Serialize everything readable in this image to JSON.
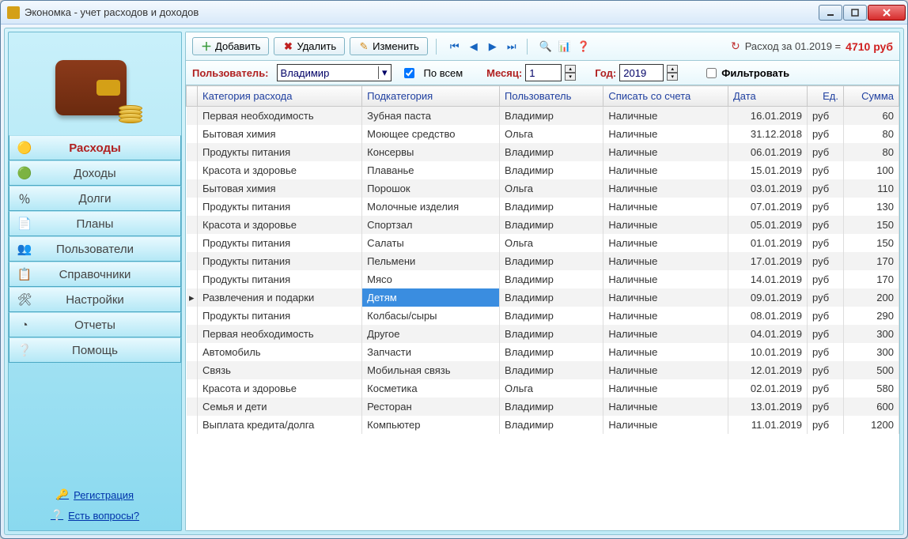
{
  "window": {
    "title": "Экономка - учет расходов и доходов"
  },
  "sidebar": {
    "items": [
      {
        "label": "Расходы",
        "icon": "coins-minus"
      },
      {
        "label": "Доходы",
        "icon": "coins-plus"
      },
      {
        "label": "Долги",
        "icon": "percent"
      },
      {
        "label": "Планы",
        "icon": "notes"
      },
      {
        "label": "Пользователи",
        "icon": "people"
      },
      {
        "label": "Справочники",
        "icon": "list"
      },
      {
        "label": "Настройки",
        "icon": "tools"
      },
      {
        "label": "Отчеты",
        "icon": "piechart"
      },
      {
        "label": "Помощь",
        "icon": "help"
      }
    ],
    "register": "Регистрация",
    "questions": "Есть вопросы?"
  },
  "toolbar": {
    "add": "Добавить",
    "delete": "Удалить",
    "edit": "Изменить",
    "summary_prefix": "Расход за 01.2019 = ",
    "summary_amount": "4710 руб"
  },
  "filter": {
    "user_label": "Пользователь:",
    "user_value": "Владимир",
    "all_label": "По всем",
    "month_label": "Месяц:",
    "month_value": "1",
    "year_label": "Год:",
    "year_value": "2019",
    "button": "Фильтровать"
  },
  "columns": [
    "Категория расхода",
    "Подкатегория",
    "Пользователь",
    "Списать со счета",
    "Дата",
    "Ед.",
    "Сумма"
  ],
  "rows": [
    {
      "cat": "Первая необходимость",
      "sub": "Зубная паста",
      "user": "Владимир",
      "acc": "Наличные",
      "date": "16.01.2019",
      "unit": "руб",
      "sum": "60"
    },
    {
      "cat": "Бытовая химия",
      "sub": "Моющее средство",
      "user": "Ольга",
      "acc": "Наличные",
      "date": "31.12.2018",
      "unit": "руб",
      "sum": "80"
    },
    {
      "cat": "Продукты питания",
      "sub": "Консервы",
      "user": "Владимир",
      "acc": "Наличные",
      "date": "06.01.2019",
      "unit": "руб",
      "sum": "80"
    },
    {
      "cat": "Красота и здоровье",
      "sub": "Плаванье",
      "user": "Владимир",
      "acc": "Наличные",
      "date": "15.01.2019",
      "unit": "руб",
      "sum": "100"
    },
    {
      "cat": "Бытовая химия",
      "sub": "Порошок",
      "user": "Ольга",
      "acc": "Наличные",
      "date": "03.01.2019",
      "unit": "руб",
      "sum": "110"
    },
    {
      "cat": "Продукты питания",
      "sub": "Молочные изделия",
      "user": "Владимир",
      "acc": "Наличные",
      "date": "07.01.2019",
      "unit": "руб",
      "sum": "130"
    },
    {
      "cat": "Красота и здоровье",
      "sub": "Спортзал",
      "user": "Владимир",
      "acc": "Наличные",
      "date": "05.01.2019",
      "unit": "руб",
      "sum": "150"
    },
    {
      "cat": "Продукты питания",
      "sub": "Салаты",
      "user": "Ольга",
      "acc": "Наличные",
      "date": "01.01.2019",
      "unit": "руб",
      "sum": "150"
    },
    {
      "cat": "Продукты питания",
      "sub": "Пельмени",
      "user": "Владимир",
      "acc": "Наличные",
      "date": "17.01.2019",
      "unit": "руб",
      "sum": "170"
    },
    {
      "cat": "Продукты питания",
      "sub": "Мясо",
      "user": "Владимир",
      "acc": "Наличные",
      "date": "14.01.2019",
      "unit": "руб",
      "sum": "170"
    },
    {
      "cat": "Развлечения и подарки",
      "sub": "Детям",
      "user": "Владимир",
      "acc": "Наличные",
      "date": "09.01.2019",
      "unit": "руб",
      "sum": "200",
      "selected": true
    },
    {
      "cat": "Продукты питания",
      "sub": "Колбасы/сыры",
      "user": "Владимир",
      "acc": "Наличные",
      "date": "08.01.2019",
      "unit": "руб",
      "sum": "290"
    },
    {
      "cat": "Первая необходимость",
      "sub": "Другое",
      "user": "Владимир",
      "acc": "Наличные",
      "date": "04.01.2019",
      "unit": "руб",
      "sum": "300"
    },
    {
      "cat": "Автомобиль",
      "sub": "Запчасти",
      "user": "Владимир",
      "acc": "Наличные",
      "date": "10.01.2019",
      "unit": "руб",
      "sum": "300"
    },
    {
      "cat": "Связь",
      "sub": "Мобильная связь",
      "user": "Владимир",
      "acc": "Наличные",
      "date": "12.01.2019",
      "unit": "руб",
      "sum": "500"
    },
    {
      "cat": "Красота и здоровье",
      "sub": "Косметика",
      "user": "Ольга",
      "acc": "Наличные",
      "date": "02.01.2019",
      "unit": "руб",
      "sum": "580"
    },
    {
      "cat": "Семья и дети",
      "sub": "Ресторан",
      "user": "Владимир",
      "acc": "Наличные",
      "date": "13.01.2019",
      "unit": "руб",
      "sum": "600"
    },
    {
      "cat": "Выплата кредита/долга",
      "sub": "Компьютер",
      "user": "Владимир",
      "acc": "Наличные",
      "date": "11.01.2019",
      "unit": "руб",
      "sum": "1200"
    }
  ]
}
